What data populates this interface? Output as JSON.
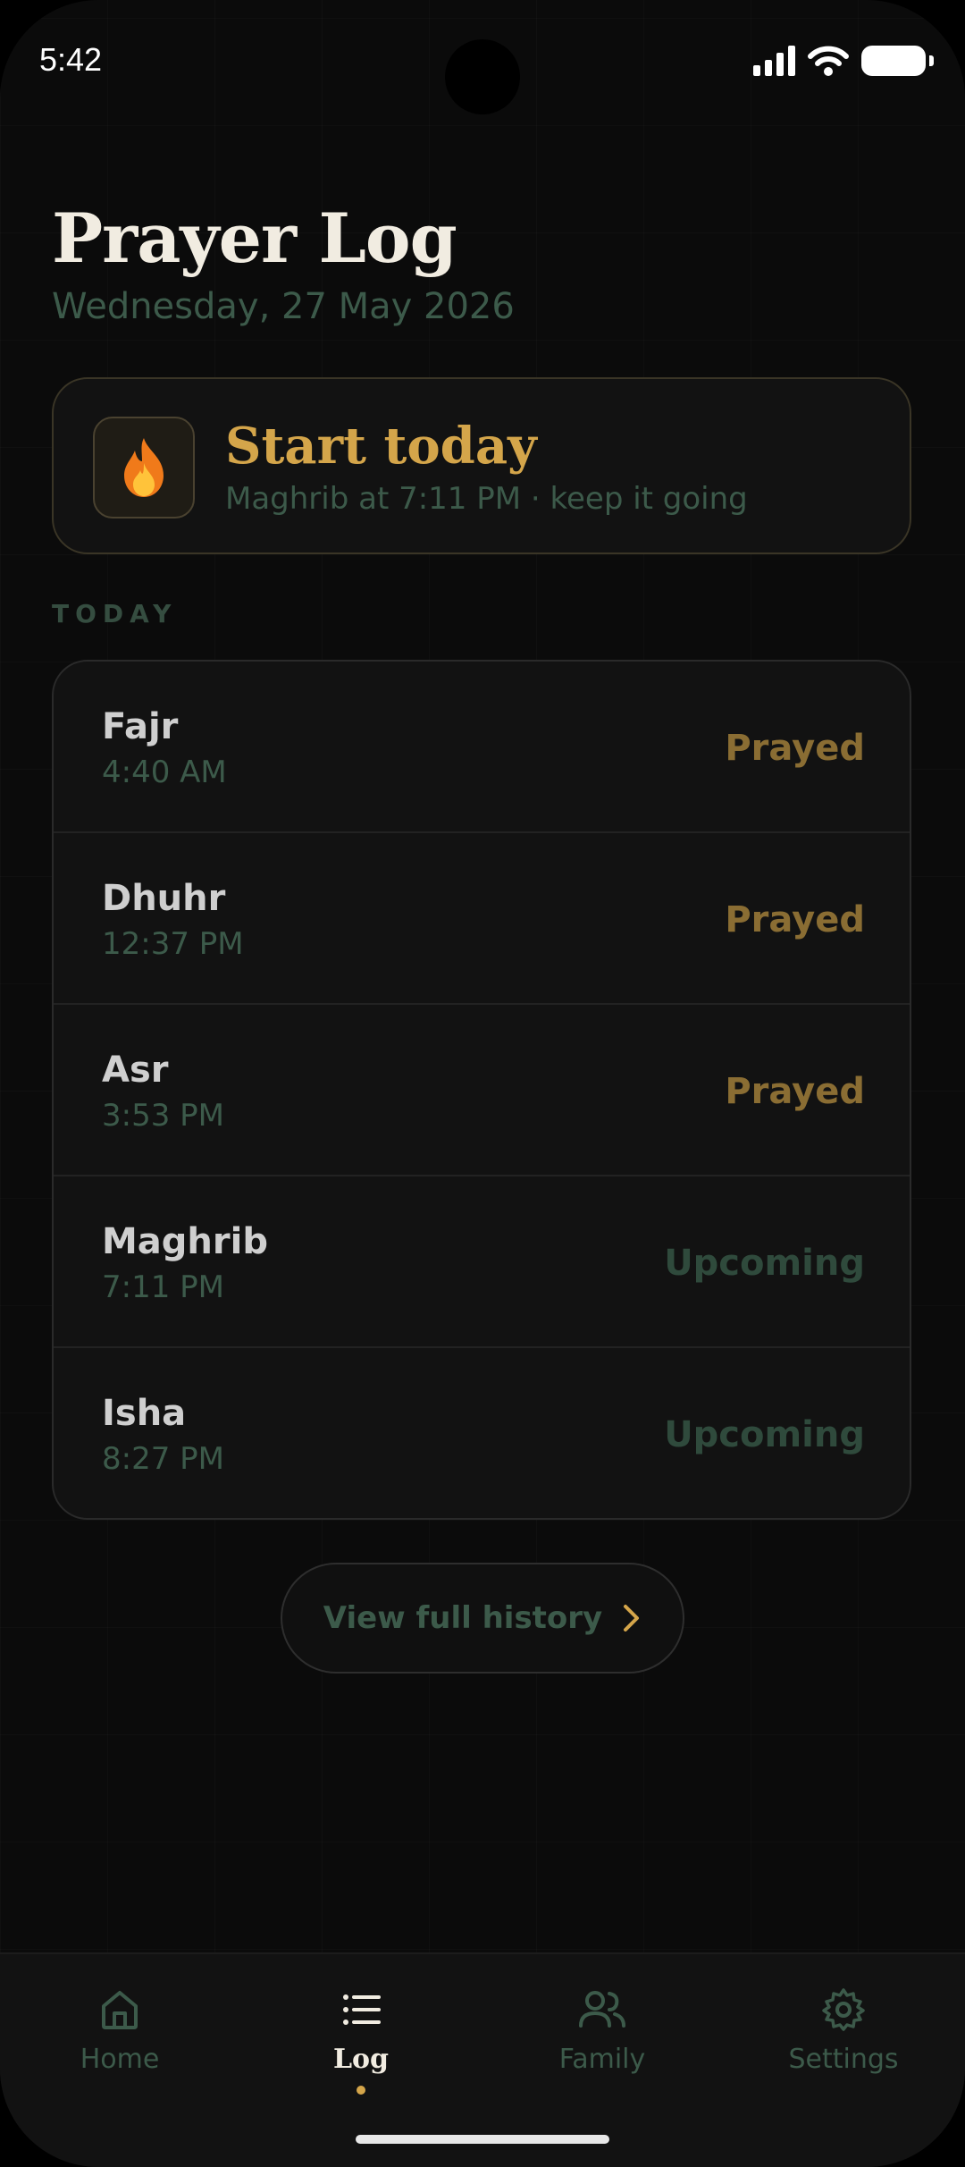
{
  "status_bar": {
    "time": "5:42"
  },
  "header": {
    "title": "Prayer Log",
    "date": "Wednesday, 27 May 2026"
  },
  "streak": {
    "title": "Start today",
    "subtitle": "Maghrib at 7:11 PM · keep it going"
  },
  "section": {
    "label": "TODAY"
  },
  "prayers": [
    {
      "name": "Fajr",
      "time": "4:40 AM",
      "status": "Prayed"
    },
    {
      "name": "Dhuhr",
      "time": "12:37 PM",
      "status": "Prayed"
    },
    {
      "name": "Asr",
      "time": "3:53 PM",
      "status": "Prayed"
    },
    {
      "name": "Maghrib",
      "time": "7:11 PM",
      "status": "Upcoming"
    },
    {
      "name": "Isha",
      "time": "8:27 PM",
      "status": "Upcoming"
    }
  ],
  "history": {
    "label": "View full history"
  },
  "tabs": [
    {
      "label": "Home",
      "icon": "home-icon",
      "active": false
    },
    {
      "label": "Log",
      "icon": "list-icon",
      "active": true
    },
    {
      "label": "Family",
      "icon": "users-icon",
      "active": false
    },
    {
      "label": "Settings",
      "icon": "gear-icon",
      "active": false
    }
  ],
  "colors": {
    "accent": "#d4a54a",
    "muted_green": "#3c5a4a",
    "prayed": "#8a6d33",
    "upcoming": "#2f4a3c",
    "background": "#0b0b0b"
  }
}
